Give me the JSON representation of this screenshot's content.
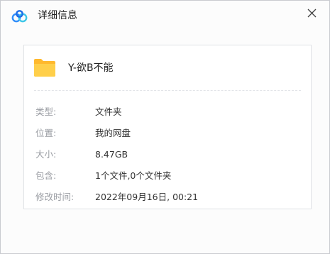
{
  "window": {
    "title": "详细信息"
  },
  "file": {
    "name": "Y-欲B不能"
  },
  "details": [
    {
      "label": "类型:",
      "value": "文件夹"
    },
    {
      "label": "位置:",
      "value": "我的网盘"
    },
    {
      "label": "大小:",
      "value": "8.47GB"
    },
    {
      "label": "包含:",
      "value": "1个文件,0个文件夹"
    },
    {
      "label": "修改时间:",
      "value": "2022年09月16日, 00:21"
    }
  ],
  "colors": {
    "brand_blue": "#2f8dfa",
    "folder_yellow": "#ffc83d"
  },
  "icons": {
    "app": "baidu-netdisk-logo-icon",
    "close": "close-icon",
    "file": "folder-icon"
  }
}
